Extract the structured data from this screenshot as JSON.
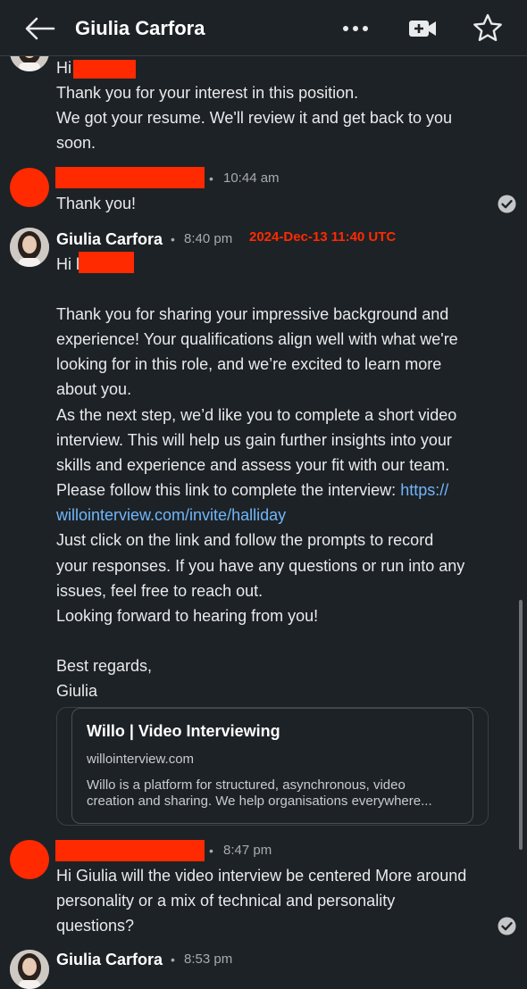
{
  "header": {
    "title": "Giulia Carfora",
    "back_icon": "arrow-left-icon",
    "more_icon": "more-horizontal-icon",
    "video_icon": "video-call-icon",
    "star_icon": "star-icon"
  },
  "messages": [
    {
      "lines": [
        "Hi",
        "Thank you for your interest in this position.",
        "We got your resume. We'll review it and get back to you",
        "soon."
      ]
    },
    {
      "sender": "",
      "time": "10:44 am",
      "lines": [
        "Thank you!"
      ]
    },
    {
      "sender": "Giulia Carfora",
      "time": "8:40 pm",
      "stamp": "2024-Dec-13 11:40 UTC",
      "greeting": "Hi l",
      "lines": [
        "Thank you for sharing your impressive background and",
        "experience! Your qualifications align well with what we're",
        "looking for in this role, and we’re excited to learn more",
        "about you.",
        "As the next step, we’d like you to complete a short video",
        "interview. This will help us gain further insights into your",
        "skills and experience and assess your fit with our team.",
        "Please follow this link to complete the interview:",
        "Just click on the link and follow the prompts to record",
        "your responses. If you have any questions or run into any",
        "issues, feel free to reach out.",
        "Looking forward to hearing from you!",
        "Best regards,",
        "Giulia"
      ],
      "link_part1": "https://",
      "link_part2": "willointerview.com/invite/halliday",
      "card": {
        "title": "Willo | Video Interviewing",
        "domain": "willointerview.com",
        "desc1": "Willo is a platform for structured, asynchronous, video",
        "desc2": "creation and sharing. We help organisations everywhere..."
      }
    },
    {
      "sender": "",
      "time": "8:47 pm",
      "lines": [
        "Hi Giulia will the video interview be centered More around",
        "personality or a mix of technical and personality",
        "questions?"
      ]
    },
    {
      "sender": "Giulia Carfora",
      "time": "8:53 pm"
    }
  ],
  "colors": {
    "background": "#1d2226",
    "redaction": "#ff2a00",
    "link": "#70b5f9"
  }
}
